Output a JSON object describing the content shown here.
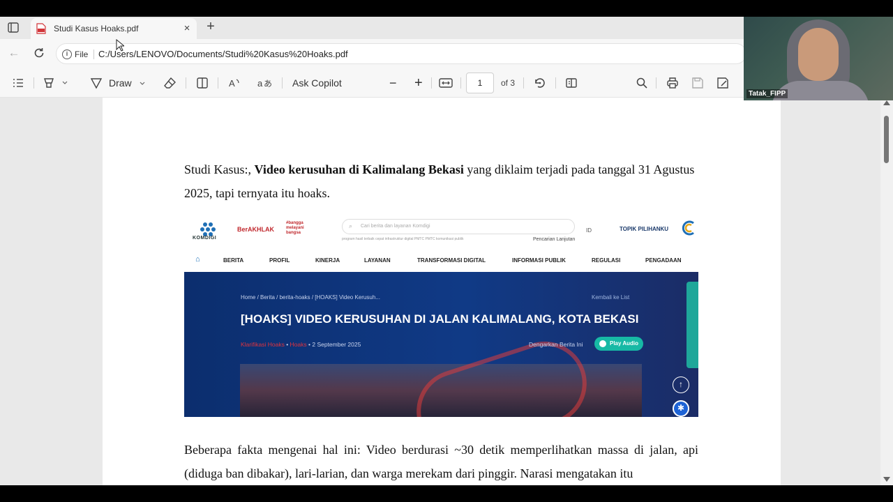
{
  "tab": {
    "title": "Studi Kasus Hoaks.pdf",
    "close_symbol": "×",
    "new_tab_symbol": "+"
  },
  "address_bar": {
    "site_label": "File",
    "url": "C:/Users/LENOVO/Documents/Studi%20Kasus%20Hoaks.pdf"
  },
  "pdf_toolbar": {
    "draw_label": "Draw",
    "copilot_label": "Ask Copilot",
    "page_current": "1",
    "page_total": "of 3",
    "zoom_out": "−",
    "zoom_in": "+"
  },
  "document": {
    "para1_prefix": "Studi Kasus:, ",
    "para1_bold": "Video kerusuhan di Kalimalang Bekasi",
    "para1_suffix": " yang diklaim terjadi pada tanggal 31 Agustus 2025, tapi ternyata itu hoaks.",
    "para2": "Beberapa fakta mengenai hal ini: Video berdurasi ~30 detik memperlihatkan massa di jalan, api (diduga ban dibakar), lari-larian, dan warga merekam dari pinggir. Narasi mengatakan itu"
  },
  "embedded_article": {
    "brand": "KOMDIGI",
    "berakhlak": "BerAKHLAK",
    "bangga": "#bangga melayani bangsa",
    "search_placeholder": "Cari berita dan layanan Komdigi",
    "search_hints": "program hasil terbaik cepat   infrastruktur digital   PMTC   PMTC   komunikasi publik",
    "advanced_search": "Pencarian Lanjutan",
    "language": "ID",
    "topik": "TOPIK PILIHANKU",
    "nav": [
      "BERITA",
      "PROFIL",
      "KINERJA",
      "LAYANAN",
      "TRANSFORMASI DIGITAL",
      "INFORMASI PUBLIK",
      "REGULASI",
      "PENGADAAN"
    ],
    "breadcrumb": "Home  /  Berita  /  berita-hoaks  /  [HOAKS] Video Kerusuh...",
    "back_to_list": "Kembali ke List",
    "headline": "[HOAKS] VIDEO KERUSUHAN DI JALAN KALIMALANG, KOTA BEKASI",
    "tag1": "Klarifikasi Hoaks",
    "tag2": "Hoaks",
    "date": "2 September 2025",
    "listen": "Dengarkan Berita Ini",
    "play": "Play Audio"
  },
  "webcam": {
    "name": "Tatak_FIPP"
  },
  "colors": {
    "komdigi_blue": "#103a86",
    "hoax_red": "#e0333d",
    "play_teal": "#17b9a5"
  }
}
